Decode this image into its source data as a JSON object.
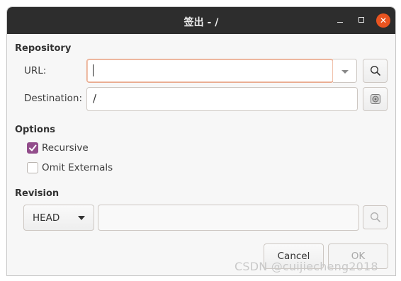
{
  "window": {
    "title": "签出 - /"
  },
  "repository": {
    "section_title": "Repository",
    "url_label": "URL:",
    "url_value": "",
    "destination_label": "Destination:",
    "destination_value": "/"
  },
  "options": {
    "section_title": "Options",
    "recursive_label": "Recursive",
    "recursive_checked": true,
    "omit_externals_label": "Omit Externals",
    "omit_externals_checked": false
  },
  "revision": {
    "section_title": "Revision",
    "selected": "HEAD",
    "value": ""
  },
  "buttons": {
    "cancel_label": "Cancel",
    "ok_label": "OK"
  },
  "watermark": "CSDN @cuijiecheng2018",
  "colors": {
    "accent": "#924d8b",
    "close_button": "#e95420",
    "titlebar": "#2d2d2d"
  }
}
